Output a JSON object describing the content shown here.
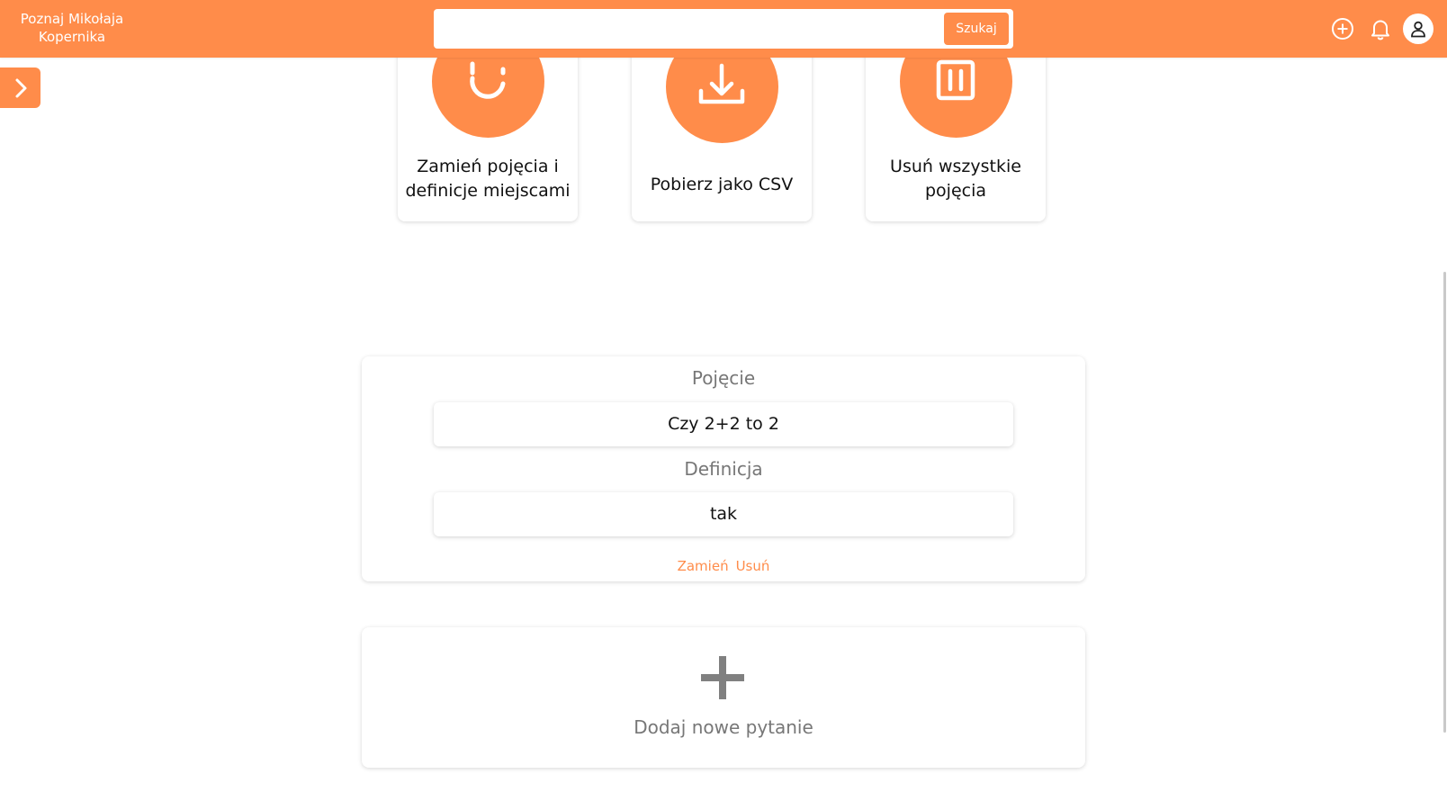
{
  "header": {
    "brand": "Poznaj Mikołaja Kopernika",
    "search": {
      "value": "",
      "placeholder": "",
      "button_label": "Szukaj"
    },
    "icons": [
      "add-circle-icon",
      "bell-icon",
      "user-icon"
    ]
  },
  "sidebar_toggle": {
    "icon": "chevron-right-icon"
  },
  "actions": [
    {
      "label": "Zamień pojęcia i definicje miejscami",
      "icon": "swap-refresh-icon"
    },
    {
      "label": "Pobierz jako CSV",
      "icon": "download-icon"
    },
    {
      "label": "Usuń wszystkie pojęcia",
      "icon": "trash-icon"
    }
  ],
  "term_card": {
    "term_label": "Pojęcie",
    "term_value": "Czy 2+2 to 2",
    "definition_label": "Definicja",
    "definition_value": "tak",
    "swap_link": "Zamień",
    "delete_link": "Usuń"
  },
  "add_card": {
    "label": "Dodaj nowe pytanie",
    "icon": "plus-icon"
  },
  "colors": {
    "accent": "#ff8c4a",
    "muted_text": "#777777",
    "background": "#ffffff"
  }
}
